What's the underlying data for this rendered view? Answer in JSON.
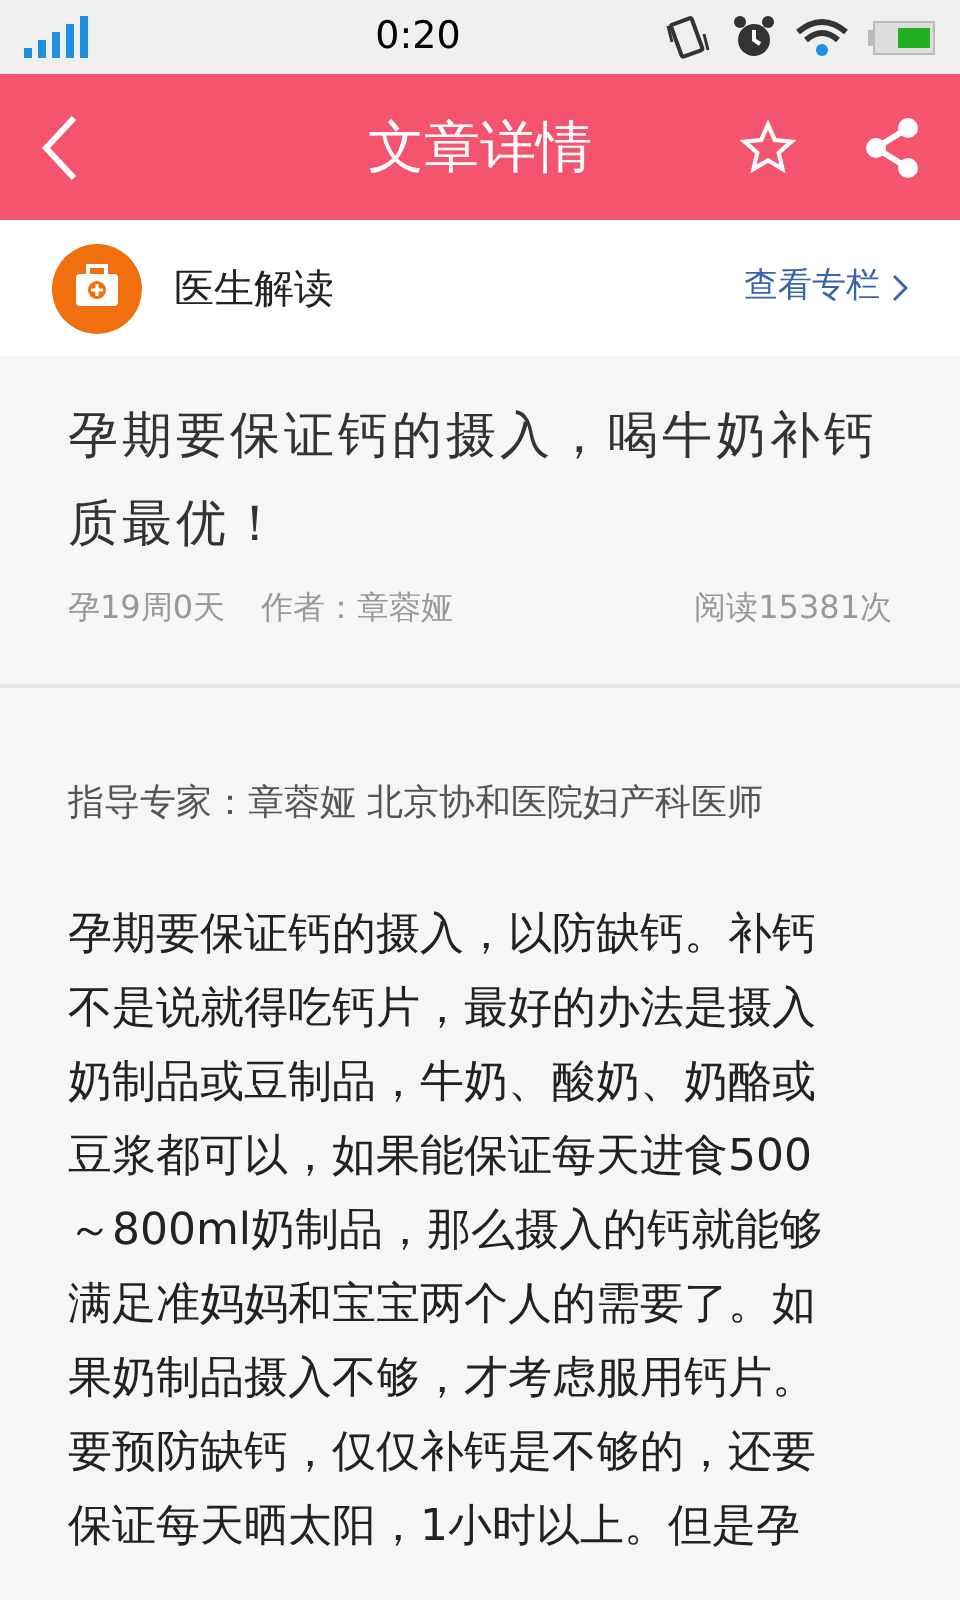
{
  "status_bar": {
    "time": "0:20"
  },
  "header": {
    "title": "文章详情"
  },
  "column_bar": {
    "label": "医生解读",
    "link": "查看专栏"
  },
  "article": {
    "title": "孕期要保证钙的摄入，喝牛奶补钙质最优！",
    "week": "孕19周0天",
    "author": "作者：章蓉娅",
    "reads": "阅读15381次",
    "expert": "指导专家：章蓉娅 北京协和医院妇产科医师",
    "body_lines": [
      "孕期要保证钙的摄入，以防缺钙。补钙",
      "不是说就得吃钙片，最好的办法是摄入",
      "奶制品或豆制品，牛奶、酸奶、奶酪或",
      "豆浆都可以，如果能保证每天进食500",
      "～800ml奶制品，那么摄入的钙就能够",
      "满足准妈妈和宝宝两个人的需要了。如",
      "果奶制品摄入不够，才考虑服用钙片。",
      "要预防缺钙，仅仅补钙是不够的，还要",
      "保证每天晒太阳，1小时以上。但是孕"
    ]
  }
}
